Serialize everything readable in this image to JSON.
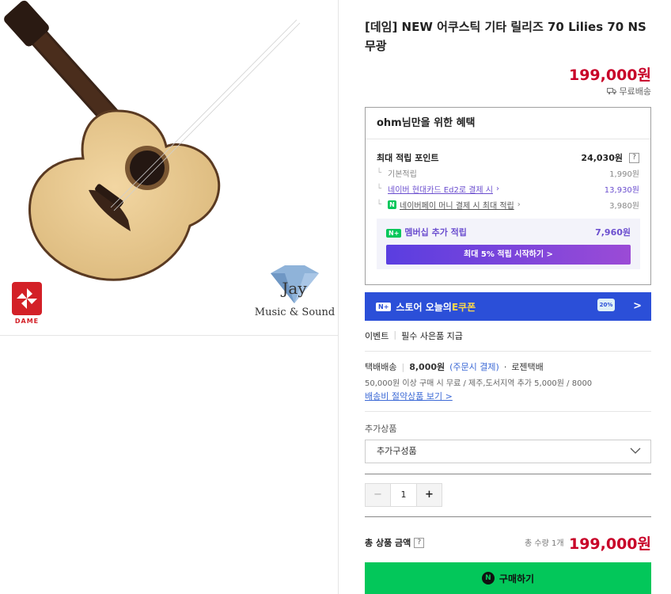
{
  "product": {
    "title": "[데임] NEW 어쿠스틱 기타 릴리즈 70 Lilies 70 NS 무광",
    "price": "199,000원",
    "shipping_badge": "무료배송"
  },
  "brand_logos": {
    "dame_text": "DAME",
    "jay_text": "Jay",
    "jay_caption": "Music & Sound"
  },
  "benefit": {
    "header": "ohm님만을 위한 혜택",
    "max_points_label": "최대 적립 포인트",
    "max_points_value": "24,030원",
    "rows": [
      {
        "label": "기본적립",
        "value": "1,990원"
      },
      {
        "label": "네이버 현대카드 Ed2로 결제 시",
        "value": "13,930원"
      },
      {
        "label": "네이버페이 머니 결제 시 최대 적립",
        "value": "3,980원"
      }
    ],
    "membership_badge": "N+",
    "membership_label": "멤버십 추가 적립",
    "membership_value": "7,960원",
    "membership_button": "최대 5% 적립 시작하기 >"
  },
  "coupon": {
    "badge": "N+",
    "text_prefix": "스토어 오늘의 ",
    "text_highlight": "E쿠폰",
    "ticket": "20%",
    "arrow": ">"
  },
  "event": {
    "label": "이벤트",
    "text": "필수 사은품 지급"
  },
  "delivery": {
    "type": "택배배송",
    "fee": "8,000원",
    "fee_note": "(주문시 결제)",
    "carrier": "로젠택배",
    "condition": "50,000원 이상 구매 시 무료 / 제주,도서지역 추가 5,000원 / 8000",
    "link": "배송비 절약상품 보기 >"
  },
  "addon": {
    "label": "추가상품",
    "select_value": "추가구성품"
  },
  "quantity": {
    "minus": "−",
    "value": "1",
    "plus": "+"
  },
  "total": {
    "label": "총 상품 금액",
    "help": "?",
    "count": "총 수량 1개",
    "price": "199,000원"
  },
  "buy_button": {
    "icon": "N",
    "label": "구매하기"
  },
  "colors": {
    "price_red": "#c80028",
    "naver_green": "#03c75a",
    "membership_purple": "#6b4ecf",
    "coupon_blue": "#2b4fd8"
  }
}
